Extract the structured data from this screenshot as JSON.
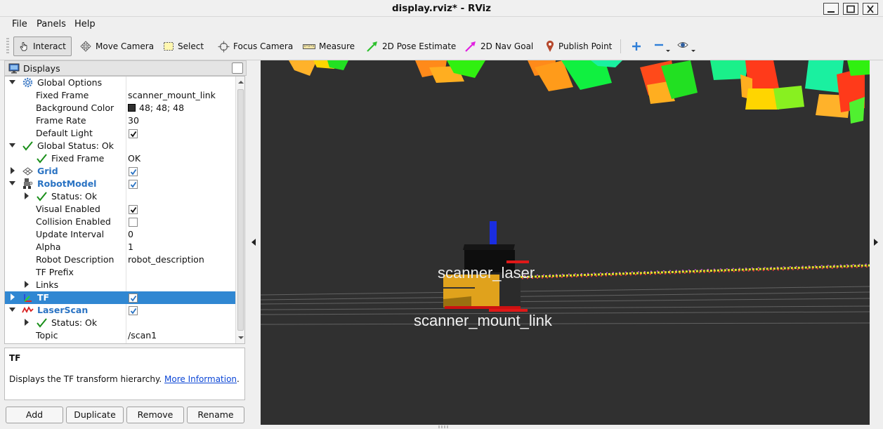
{
  "window": {
    "title": "display.rviz* - RViz"
  },
  "menu": [
    "File",
    "Panels",
    "Help"
  ],
  "toolbar": {
    "tools": [
      {
        "label": "Interact",
        "icon": "hand-pointer-icon",
        "active": true
      },
      {
        "label": "Move Camera",
        "icon": "move-camera-icon"
      },
      {
        "label": "Select",
        "icon": "select-box-icon"
      },
      {
        "label": "Focus Camera",
        "icon": "crosshair-icon"
      },
      {
        "label": "Measure",
        "icon": "ruler-icon"
      },
      {
        "label": "2D Pose Estimate",
        "icon": "green-arrow-icon",
        "color": "#2ec12e"
      },
      {
        "label": "2D Nav Goal",
        "icon": "magenta-arrow-icon",
        "color": "#e020e0"
      },
      {
        "label": "Publish Point",
        "icon": "map-pin-icon",
        "color": "#b5482d"
      }
    ],
    "extra_icons": [
      "zoom-in-plus-icon",
      "zoom-out-minus-icon",
      "eye-view-icon"
    ]
  },
  "displays_panel": {
    "title": "Displays",
    "rows": [
      {
        "label": "Global Options",
        "value": ""
      },
      {
        "label": "Fixed Frame",
        "value": "scanner_mount_link"
      },
      {
        "label": "Background Color",
        "value": "48; 48; 48",
        "swatch": "#303030"
      },
      {
        "label": "Frame Rate",
        "value": "30"
      },
      {
        "label": "Default Light",
        "checked": true
      },
      {
        "label": "Global Status: Ok",
        "value": ""
      },
      {
        "label": "Fixed Frame",
        "value": "OK"
      },
      {
        "label": "Grid",
        "checked": true
      },
      {
        "label": "RobotModel",
        "checked": true
      },
      {
        "label": "Status: Ok",
        "value": ""
      },
      {
        "label": "Visual Enabled",
        "checked": true
      },
      {
        "label": "Collision Enabled",
        "checked": false
      },
      {
        "label": "Update Interval",
        "value": "0"
      },
      {
        "label": "Alpha",
        "value": "1"
      },
      {
        "label": "Robot Description",
        "value": "robot_description"
      },
      {
        "label": "TF Prefix",
        "value": ""
      },
      {
        "label": "Links",
        "value": ""
      },
      {
        "label": "TF",
        "checked": true,
        "selected": true
      },
      {
        "label": "LaserScan",
        "checked": true
      },
      {
        "label": "Status: Ok",
        "value": ""
      },
      {
        "label": "Topic",
        "value": "/scan1"
      }
    ]
  },
  "description": {
    "title": "TF",
    "text": "Displays the TF transform hierarchy.",
    "link": "More Information",
    "after_link": "."
  },
  "buttons": [
    "Add",
    "Duplicate",
    "Remove",
    "Rename"
  ],
  "view": {
    "background": "#303030",
    "frame_labels": [
      "scanner_laser",
      "scanner_mount_link"
    ]
  }
}
